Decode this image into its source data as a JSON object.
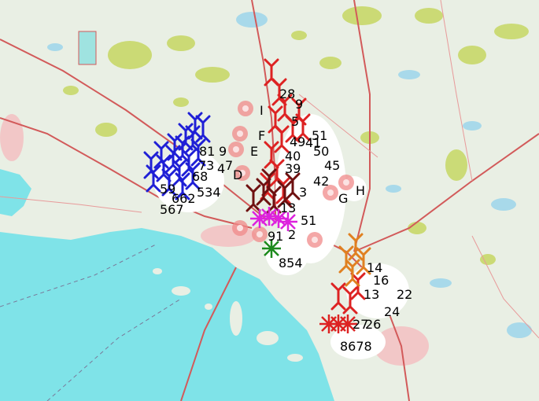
{
  "map": {
    "colors": {
      "sea": "#7fe3e8",
      "land": "#e9efe4",
      "lake": "#a8d9ea",
      "forest": "#c8d86a",
      "road": "#d25a5a",
      "urban": "#f2c7c7"
    },
    "site_letters": [
      "I",
      "F",
      "E",
      "D",
      "G",
      "H"
    ],
    "number_labels": [
      "28",
      "9",
      "5",
      "51",
      "49",
      "41",
      "50",
      "40",
      "39",
      "45",
      "42",
      "81",
      "9",
      "7",
      "73",
      "4",
      "68",
      "59",
      "662",
      "534",
      "3",
      "567",
      "13",
      "51",
      "91",
      "2",
      "854",
      "14",
      "16",
      "13",
      "22",
      "24",
      "27",
      "26",
      "8678"
    ],
    "turbine_groups": [
      {
        "color": "#1f1fd6",
        "symbol": "wind-turbine"
      },
      {
        "color": "#dd2222",
        "symbol": "wind-turbine"
      },
      {
        "color": "#6e1010",
        "symbol": "wind-turbine"
      },
      {
        "color": "#e08020",
        "symbol": "wind-turbine"
      },
      {
        "color": "#dd22dd",
        "symbol": "asterisk"
      },
      {
        "color": "#1d8a1d",
        "symbol": "asterisk"
      }
    ],
    "site_marker_color": "#f08a8a"
  }
}
